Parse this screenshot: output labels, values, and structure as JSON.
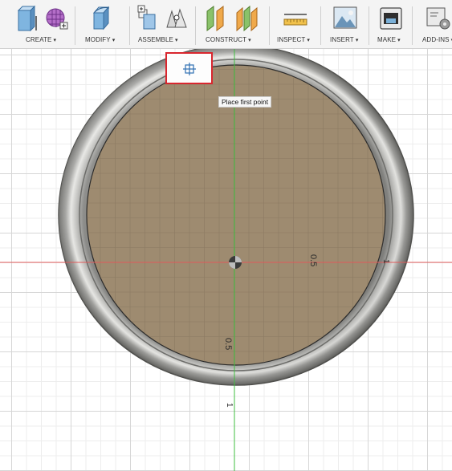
{
  "toolbar": {
    "groups": [
      {
        "label": "CREATE"
      },
      {
        "label": "MODIFY"
      },
      {
        "label": "ASSEMBLE"
      },
      {
        "label": "CONSTRUCT"
      },
      {
        "label": "INSPECT"
      },
      {
        "label": "INSERT"
      },
      {
        "label": "MAKE"
      },
      {
        "label": "ADD-INS"
      }
    ]
  },
  "canvas": {
    "tooltip": "Place first point",
    "dimensions": {
      "radius_right": "0.5",
      "radius_down": "0.5",
      "edge_right": "1",
      "edge_bottom": "1"
    }
  },
  "colors": {
    "accent_red": "#d9262e",
    "x_axis": "#e05a5a",
    "y_axis": "#3fbf3f",
    "sketch_fill": "#9e8b70",
    "rim": "#8a8a87"
  },
  "icons": {
    "create": [
      "extrude-icon",
      "form-grid-icon"
    ],
    "modify": "press-pull-icon",
    "assemble": [
      "new-component-icon",
      "joint-icon"
    ],
    "construct": [
      "offset-plane-icon",
      "midplane-icon"
    ],
    "inspect": "measure-icon",
    "insert": "image-icon",
    "make": "3d-print-icon",
    "add_ins": "scripts-icon",
    "tool": "place-point-icon"
  }
}
